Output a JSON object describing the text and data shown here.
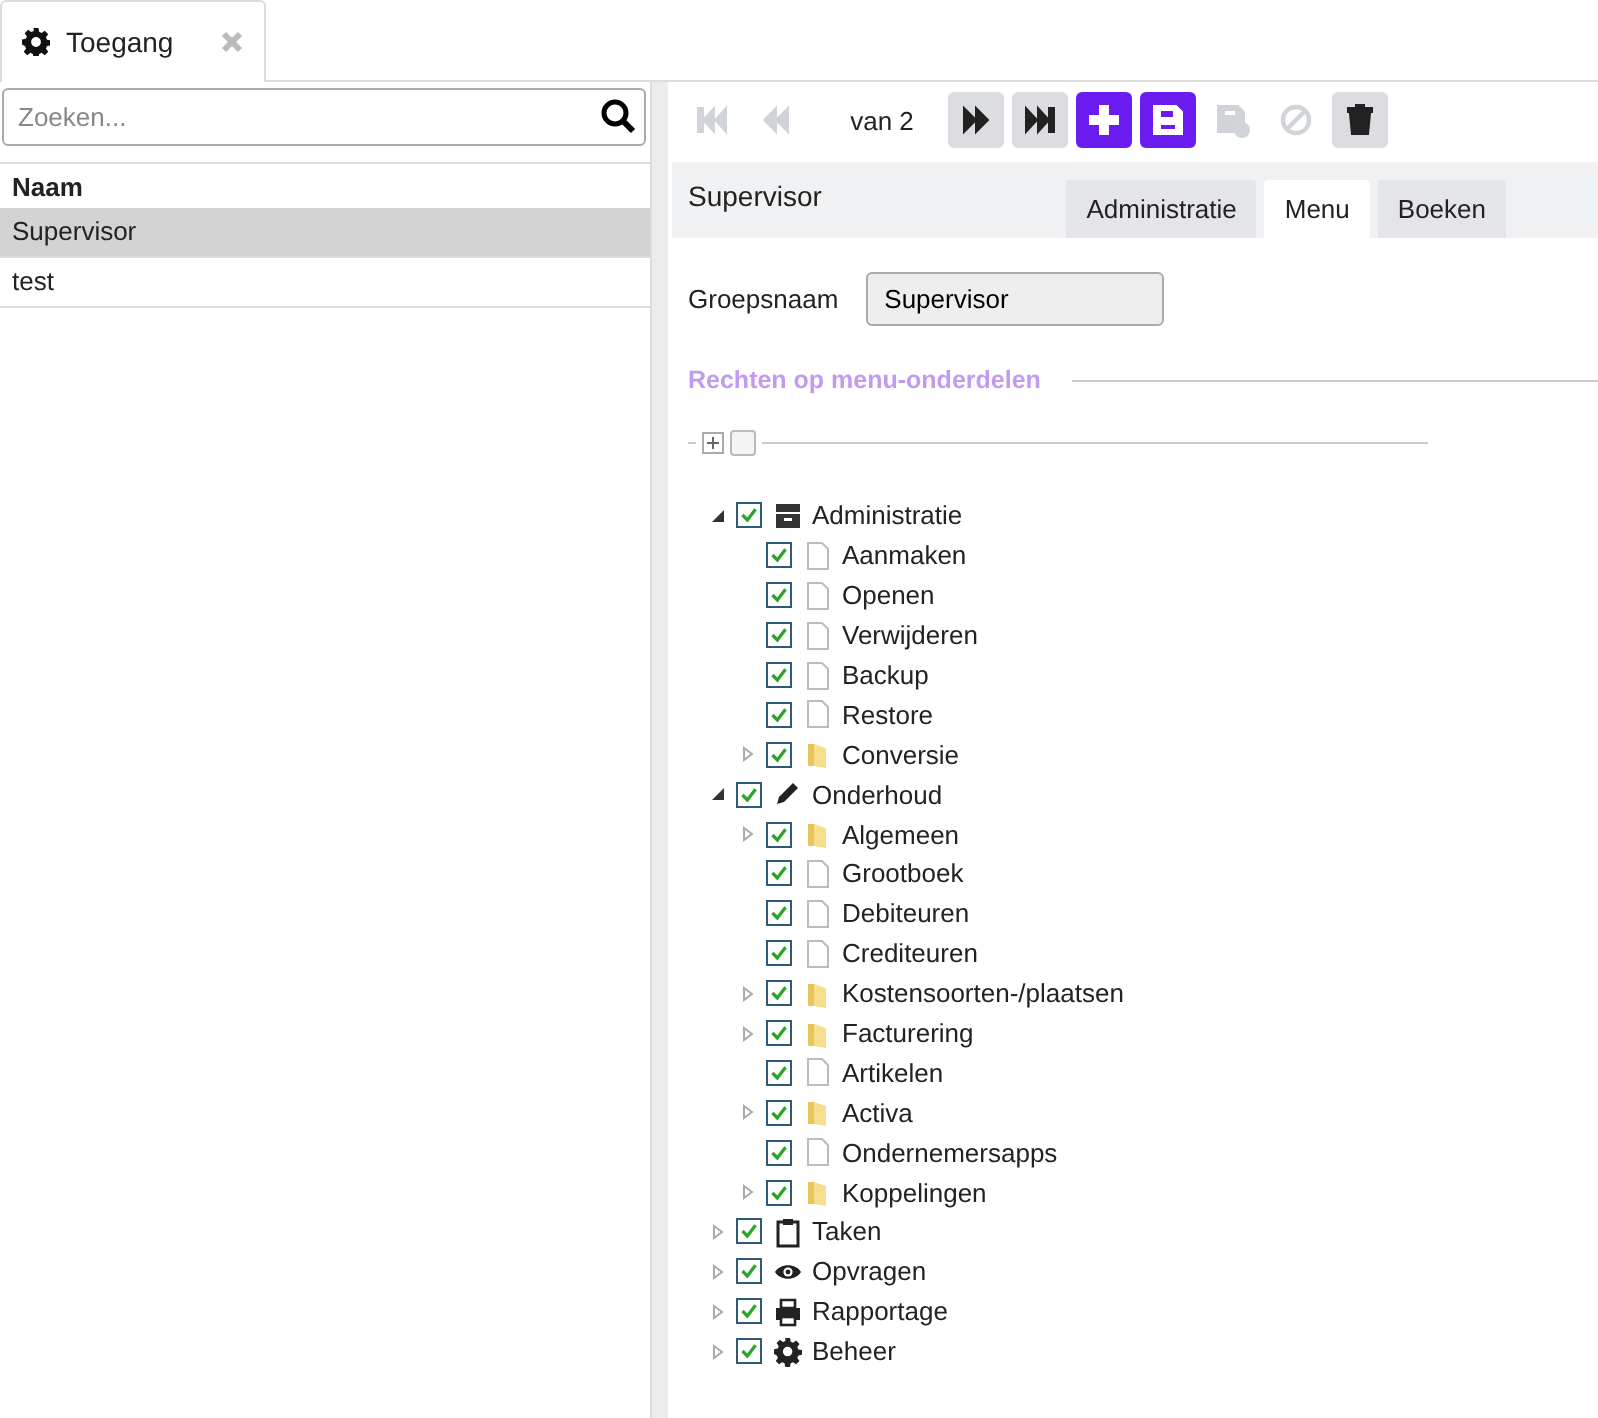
{
  "window_tab": {
    "label": "Toegang",
    "selected": true
  },
  "search": {
    "placeholder": "Zoeken..."
  },
  "list": {
    "column": "Naam",
    "rows": [
      {
        "name": "Supervisor",
        "selected": true
      },
      {
        "name": "test",
        "selected": false
      }
    ]
  },
  "toolbar": {
    "buttons": [
      {
        "kind": "first",
        "disabled": true
      },
      {
        "kind": "prev",
        "disabled": true
      },
      {
        "kind": "next",
        "disabled": false
      },
      {
        "kind": "last",
        "disabled": false
      },
      {
        "kind": "add",
        "disabled": false
      },
      {
        "kind": "save",
        "disabled": false
      },
      {
        "kind": "saveas",
        "disabled": true
      },
      {
        "kind": "cancel",
        "disabled": true
      },
      {
        "kind": "delete",
        "disabled": false
      }
    ],
    "pager": "van 2"
  },
  "record_title": "Supervisor",
  "tabs": [
    {
      "label": "Administratie",
      "selected": false
    },
    {
      "label": "Menu",
      "selected": true
    },
    {
      "label": "Boeken",
      "selected": false
    }
  ],
  "form": {
    "label": "Groepsnaam",
    "value": "Supervisor"
  },
  "section_title": "Rechten op menu-onderdelen",
  "tree_toolbar": {
    "select_all": false
  },
  "tree": [
    {
      "label": "Administratie",
      "kind": "archive",
      "checked": true,
      "expanded": true,
      "children": [
        {
          "label": "Aanmaken",
          "kind": "file",
          "checked": true
        },
        {
          "label": "Openen",
          "kind": "file",
          "checked": true
        },
        {
          "label": "Verwijderen",
          "kind": "file",
          "checked": true
        },
        {
          "label": "Backup",
          "kind": "file",
          "checked": true
        },
        {
          "label": "Restore",
          "kind": "file",
          "checked": true
        },
        {
          "label": "Conversie",
          "kind": "folder",
          "checked": true,
          "expanded": false
        }
      ]
    },
    {
      "label": "Onderhoud",
      "kind": "pencil",
      "checked": true,
      "expanded": true,
      "children": [
        {
          "label": "Algemeen",
          "kind": "folder",
          "checked": true,
          "expanded": false
        },
        {
          "label": "Grootboek",
          "kind": "file",
          "checked": true
        },
        {
          "label": "Debiteuren",
          "kind": "file",
          "checked": true
        },
        {
          "label": "Crediteuren",
          "kind": "file",
          "checked": true
        },
        {
          "label": "Kostensoorten-/plaatsen",
          "kind": "folder",
          "checked": true,
          "expanded": false
        },
        {
          "label": "Facturering",
          "kind": "folder",
          "checked": true,
          "expanded": false
        },
        {
          "label": "Artikelen",
          "kind": "file",
          "checked": true
        },
        {
          "label": "Activa",
          "kind": "folder",
          "checked": true,
          "expanded": false
        },
        {
          "label": "Ondernemersapps",
          "kind": "file",
          "checked": true
        },
        {
          "label": "Koppelingen",
          "kind": "folder",
          "checked": true,
          "expanded": false
        }
      ]
    },
    {
      "label": "Taken",
      "kind": "clipboard",
      "checked": true,
      "expanded": false
    },
    {
      "label": "Opvragen",
      "kind": "eye",
      "checked": true,
      "expanded": false
    },
    {
      "label": "Rapportage",
      "kind": "printer",
      "checked": true,
      "expanded": false
    },
    {
      "label": "Beheer",
      "kind": "gear",
      "checked": true,
      "expanded": false
    }
  ]
}
